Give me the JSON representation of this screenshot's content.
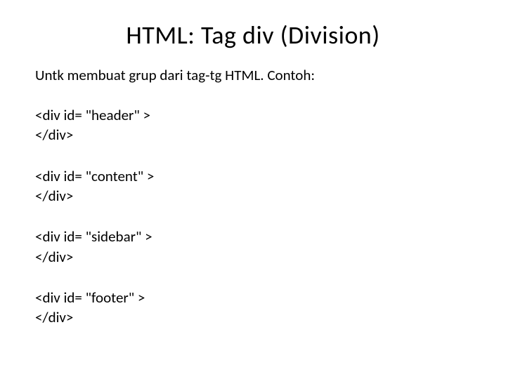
{
  "title": "HTML: Tag div (Division)",
  "description": "Untk membuat grup dari tag-tg HTML. Contoh:",
  "examples": [
    {
      "open": "<div id= \"header\" >",
      "close": "</div>"
    },
    {
      "open": "<div id= \"content\" >",
      "close": "</div>"
    },
    {
      "open": "<div id= \"sidebar\" >",
      "close": "</div>"
    },
    {
      "open": "<div id= \"footer\" >",
      "close": "</div>"
    }
  ]
}
